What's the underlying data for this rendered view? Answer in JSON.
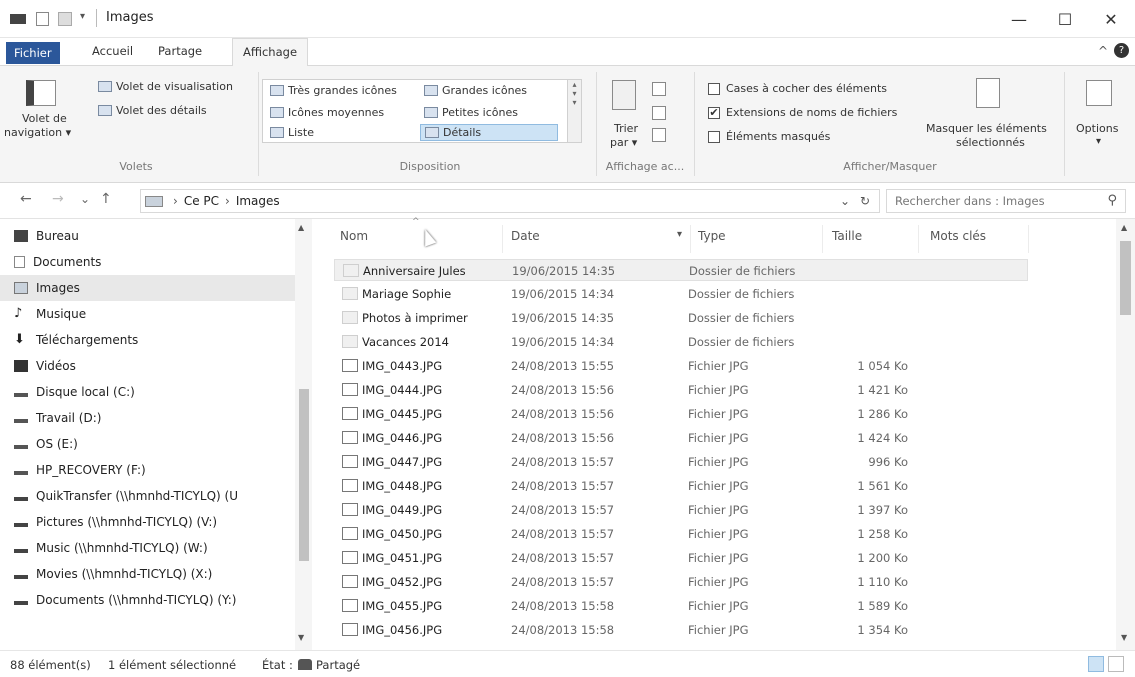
{
  "window": {
    "title": "Images",
    "minimize_icon": "—",
    "maximize_icon": "☐",
    "close_icon": "✕"
  },
  "ribbon_tabs": {
    "file": "Fichier",
    "home": "Accueil",
    "share": "Partage",
    "view": "Affichage",
    "collapse_icon": "^",
    "help_icon": "?"
  },
  "ribbon": {
    "panes": {
      "nav_pane_line1": "Volet de",
      "nav_pane_line2": "navigation ▾",
      "preview_pane": "Volet de visualisation",
      "details_pane": "Volet des détails",
      "group_label": "Volets"
    },
    "layout": {
      "extra_large_icons": "Très grandes icônes",
      "large_icons": "Grandes icônes",
      "medium_icons": "Icônes moyennes",
      "small_icons": "Petites icônes",
      "list": "Liste",
      "details": "Détails",
      "group_label": "Disposition"
    },
    "current_view": {
      "sort_line1": "Trier",
      "sort_line2": "par ▾",
      "group_label": "Affichage ac..."
    },
    "show_hide": {
      "item_checkboxes": "Cases à cocher des éléments",
      "file_extensions": "Extensions de noms de fichiers",
      "hidden_items": "Éléments masqués",
      "hide_selected_line1": "Masquer les éléments",
      "hide_selected_line2": "sélectionnés",
      "group_label": "Afficher/Masquer"
    },
    "options_label": "Options",
    "options_arrow": "▾"
  },
  "address": {
    "back_icon": "←",
    "forward_icon": "→",
    "recent_icon": "⌄",
    "up_icon": "↑",
    "path_sep": "›",
    "crumb_pc": "Ce PC",
    "crumb_images": "Images",
    "dropdown_icon": "⌄",
    "refresh_icon": "↻",
    "search_placeholder": "Rechercher dans : Images",
    "search_icon": "⚲"
  },
  "nav_items": [
    {
      "label": "Bureau"
    },
    {
      "label": "Documents"
    },
    {
      "label": "Images"
    },
    {
      "label": "Musique"
    },
    {
      "label": "Téléchargements"
    },
    {
      "label": "Vidéos"
    },
    {
      "label": "Disque local (C:)"
    },
    {
      "label": "Travail (D:)"
    },
    {
      "label": "OS (E:)"
    },
    {
      "label": "HP_RECOVERY (F:)"
    },
    {
      "label": "QuikTransfer (\\\\hmnhd-TICYLQ) (U"
    },
    {
      "label": "Pictures (\\\\hmnhd-TICYLQ) (V:)"
    },
    {
      "label": "Music (\\\\hmnhd-TICYLQ) (W:)"
    },
    {
      "label": "Movies (\\\\hmnhd-TICYLQ) (X:)"
    },
    {
      "label": "Documents (\\\\hmnhd-TICYLQ) (Y:)"
    }
  ],
  "columns": {
    "name": "Nom",
    "date": "Date",
    "type": "Type",
    "size": "Taille",
    "tags": "Mots clés",
    "sort_indicator": "^",
    "date_dropdown": "▾"
  },
  "files": [
    {
      "name": "Anniversaire Jules",
      "date": "19/06/2015 14:35",
      "type": "Dossier de fichiers",
      "size": ""
    },
    {
      "name": "Mariage Sophie",
      "date": "19/06/2015 14:34",
      "type": "Dossier de fichiers",
      "size": ""
    },
    {
      "name": "Photos à imprimer",
      "date": "19/06/2015 14:35",
      "type": "Dossier de fichiers",
      "size": ""
    },
    {
      "name": "Vacances 2014",
      "date": "19/06/2015 14:34",
      "type": "Dossier de fichiers",
      "size": ""
    },
    {
      "name": "IMG_0443.JPG",
      "date": "24/08/2013 15:55",
      "type": "Fichier JPG",
      "size": "1 054 Ko"
    },
    {
      "name": "IMG_0444.JPG",
      "date": "24/08/2013 15:56",
      "type": "Fichier JPG",
      "size": "1 421 Ko"
    },
    {
      "name": "IMG_0445.JPG",
      "date": "24/08/2013 15:56",
      "type": "Fichier JPG",
      "size": "1 286 Ko"
    },
    {
      "name": "IMG_0446.JPG",
      "date": "24/08/2013 15:56",
      "type": "Fichier JPG",
      "size": "1 424 Ko"
    },
    {
      "name": "IMG_0447.JPG",
      "date": "24/08/2013 15:57",
      "type": "Fichier JPG",
      "size": "996 Ko"
    },
    {
      "name": "IMG_0448.JPG",
      "date": "24/08/2013 15:57",
      "type": "Fichier JPG",
      "size": "1 561 Ko"
    },
    {
      "name": "IMG_0449.JPG",
      "date": "24/08/2013 15:57",
      "type": "Fichier JPG",
      "size": "1 397 Ko"
    },
    {
      "name": "IMG_0450.JPG",
      "date": "24/08/2013 15:57",
      "type": "Fichier JPG",
      "size": "1 258 Ko"
    },
    {
      "name": "IMG_0451.JPG",
      "date": "24/08/2013 15:57",
      "type": "Fichier JPG",
      "size": "1 200 Ko"
    },
    {
      "name": "IMG_0452.JPG",
      "date": "24/08/2013 15:57",
      "type": "Fichier JPG",
      "size": "1 110 Ko"
    },
    {
      "name": "IMG_0455.JPG",
      "date": "24/08/2013 15:58",
      "type": "Fichier JPG",
      "size": "1 589 Ko"
    },
    {
      "name": "IMG_0456.JPG",
      "date": "24/08/2013 15:58",
      "type": "Fichier JPG",
      "size": "1 354 Ko"
    }
  ],
  "status": {
    "item_count": "88 élément(s)",
    "selected": "1 élément sélectionné",
    "state_label": "État :",
    "state_value": "Partagé"
  },
  "colors": {
    "file_tab": "#2b579a",
    "selection": "#cde3f5"
  }
}
